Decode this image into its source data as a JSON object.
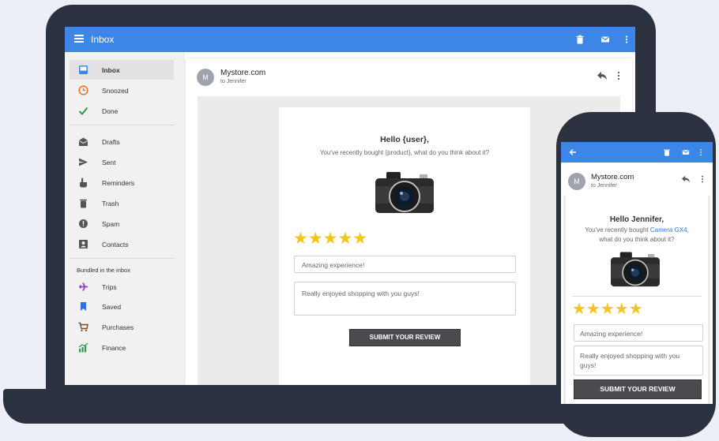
{
  "laptop": {
    "topbar": {
      "title": "Inbox"
    },
    "sidebar": {
      "items": [
        {
          "label": "Inbox",
          "icon": "inbox-icon",
          "active": true
        },
        {
          "label": "Snoozed",
          "icon": "clock-icon"
        },
        {
          "label": "Done",
          "icon": "check-icon"
        },
        {
          "label": "Drafts",
          "icon": "drafts-icon"
        },
        {
          "label": "Sent",
          "icon": "send-icon"
        },
        {
          "label": "Reminders",
          "icon": "hand-icon"
        },
        {
          "label": "Trash",
          "icon": "trash-icon"
        },
        {
          "label": "Spam",
          "icon": "spam-icon"
        },
        {
          "label": "Contacts",
          "icon": "contacts-icon"
        }
      ],
      "section_label": "Bundled in the inbox",
      "bundles": [
        {
          "label": "Trips",
          "icon": "plane-icon"
        },
        {
          "label": "Saved",
          "icon": "bookmark-icon"
        },
        {
          "label": "Purchases",
          "icon": "cart-icon"
        },
        {
          "label": "Finance",
          "icon": "chart-icon"
        }
      ]
    },
    "mail": {
      "avatar": "M",
      "sender": "Mystore.com",
      "recipient": "to Jennifer",
      "greeting": "Hello {user},",
      "question": "You've recently bought {product}, what do you think about it?",
      "stars": "★★★★★",
      "rating": 5,
      "title_field": "Amazing experience!",
      "review_field": "Really enjoyed shopping with you guys!",
      "submit_label": "SUBMIT YOUR REVIEW"
    }
  },
  "phone": {
    "mail": {
      "avatar": "M",
      "sender": "Mystore.com",
      "recipient": "to Jennifer",
      "greeting": "Hello Jennifer,",
      "question_pre": "You've recently bought",
      "product": "Camera GX4",
      "question_post": "what do you think about it?",
      "stars": "★★★★★",
      "rating": 5,
      "title_field": "Amazing experience!",
      "review_field": "Really enjoyed shopping with you guys!",
      "submit_label": "SUBMIT YOUR REVIEW"
    }
  },
  "colors": {
    "accent": "#3b86e6",
    "star": "#f5c518",
    "device": "#2c3140",
    "link": "#2d7be0"
  }
}
